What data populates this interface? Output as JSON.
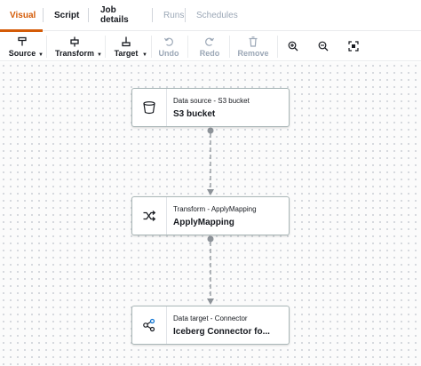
{
  "tabs": [
    {
      "label": "Visual",
      "state": "active"
    },
    {
      "label": "Script",
      "state": "normal"
    },
    {
      "label": "Job details",
      "state": "normal"
    },
    {
      "label": "Runs",
      "state": "disabled"
    },
    {
      "label": "Schedules",
      "state": "disabled"
    }
  ],
  "toolbar": {
    "source": "Source",
    "transform": "Transform",
    "target": "Target",
    "undo": "Undo",
    "redo": "Redo",
    "remove": "Remove",
    "icons": [
      "source-icon",
      "transform-icon",
      "target-icon",
      "undo-icon",
      "redo-icon",
      "trash-icon",
      "zoom-in-icon",
      "zoom-out-icon",
      "fit-screen-icon"
    ]
  },
  "nodes": [
    {
      "subtitle": "Data source - S3 bucket",
      "title": "S3 bucket",
      "icon": "bucket-icon"
    },
    {
      "subtitle": "Transform - ApplyMapping",
      "title": "ApplyMapping",
      "icon": "shuffle-icon"
    },
    {
      "subtitle": "Data target - Connector",
      "title": "Iceberg Connector fo...",
      "icon": "connector-icon"
    }
  ],
  "colors": {
    "accent": "#d45b07",
    "edge": "#8d9399",
    "disabled": "#9ba7b6",
    "connector_icon": "#0972d3"
  }
}
